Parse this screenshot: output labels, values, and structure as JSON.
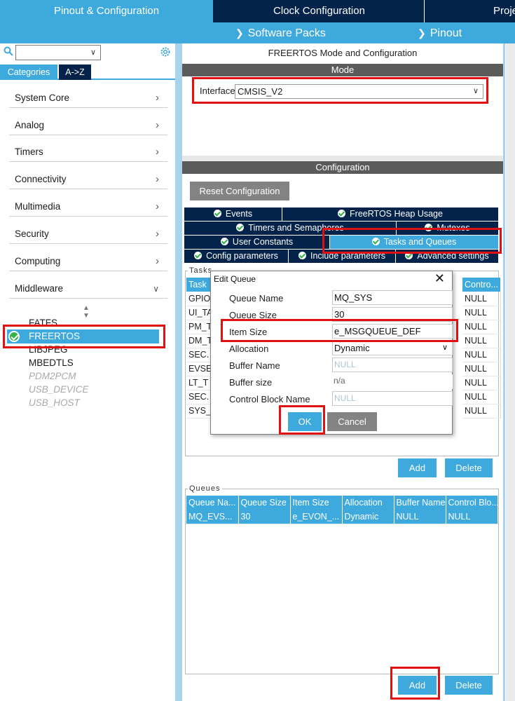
{
  "top_tabs": [
    "Pinout & Configuration",
    "Clock Configuration",
    "Proje"
  ],
  "sub_bar": {
    "software_packs": "Software Packs",
    "pinout": "Pinout"
  },
  "left": {
    "search_value": "",
    "category_tabs": [
      "Categories",
      "A->Z"
    ],
    "categories": [
      "System Core",
      "Analog",
      "Timers",
      "Connectivity",
      "Multimedia",
      "Security",
      "Computing",
      "Middleware"
    ],
    "middleware_items": [
      "FATFS",
      "FREERTOS",
      "LIBJPEG",
      "MBEDTLS",
      "PDM2PCM",
      "USB_DEVICE",
      "USB_HOST"
    ],
    "selected_middleware": "FREERTOS"
  },
  "main": {
    "title": "FREERTOS Mode and Configuration",
    "mode_header": "Mode",
    "interface_label": "Interface",
    "interface_value": "CMSIS_V2",
    "config_header": "Configuration",
    "reset_button": "Reset Configuration",
    "tabs": {
      "events": "Events",
      "heap": "FreeRTOS Heap Usage",
      "timers": "Timers and Semaphores",
      "mutexes": "Mutexes",
      "user_constants": "User Constants",
      "tasks_queues": "Tasks and Queues",
      "config_params": "Config parameters",
      "include_params": "Include parameters",
      "advanced": "Advanced settings"
    },
    "tasks_legend": "Tasks",
    "tasks_header_first": "Task",
    "tasks_header_last": "Contro...",
    "tasks_rows": [
      {
        "name": "GPIO",
        "cb": "NULL"
      },
      {
        "name": "UI_TA",
        "cb": "NULL"
      },
      {
        "name": "PM_T",
        "cb": "NULL"
      },
      {
        "name": "DM_T",
        "cb": "NULL"
      },
      {
        "name": "SEC.",
        "cb": "NULL"
      },
      {
        "name": "EVSE",
        "cb": "NULL"
      },
      {
        "name": "LT_T",
        "cb": "NULL"
      },
      {
        "name": "SEC.",
        "cb": "NULL"
      },
      {
        "name": "SYS_",
        "cb": "NULL"
      }
    ],
    "tasks_add": "Add",
    "tasks_delete": "Delete",
    "queues_legend": "Queues",
    "queues_columns": [
      "Queue Na...",
      "Queue Size",
      "Item Size",
      "Allocation",
      "Buffer Name",
      "Control Blo..."
    ],
    "queues_rows": [
      [
        "MQ_EVS...",
        "30",
        "e_EVON_...",
        "Dynamic",
        "NULL",
        "NULL"
      ]
    ],
    "queues_add": "Add",
    "queues_delete": "Delete"
  },
  "dialog": {
    "title": "Edit Queue",
    "labels": {
      "queue_name": "Queue Name",
      "queue_size": "Queue Size",
      "item_size": "Item Size",
      "allocation": "Allocation",
      "buffer_name": "Buffer Name",
      "buffer_size": "Buffer size",
      "control_block": "Control Block Name"
    },
    "values": {
      "queue_name": "MQ_SYS",
      "queue_size": "30",
      "item_size": "e_MSGQUEUE_DEF",
      "allocation": "Dynamic",
      "buffer_name": "NULL",
      "buffer_size": "n/a",
      "control_block": "NULL"
    },
    "ok": "OK",
    "cancel": "Cancel"
  },
  "colors": {
    "accent": "#3ea9dc",
    "navy": "#03234b",
    "highlight": "#e01010",
    "grey_button": "#838383"
  }
}
